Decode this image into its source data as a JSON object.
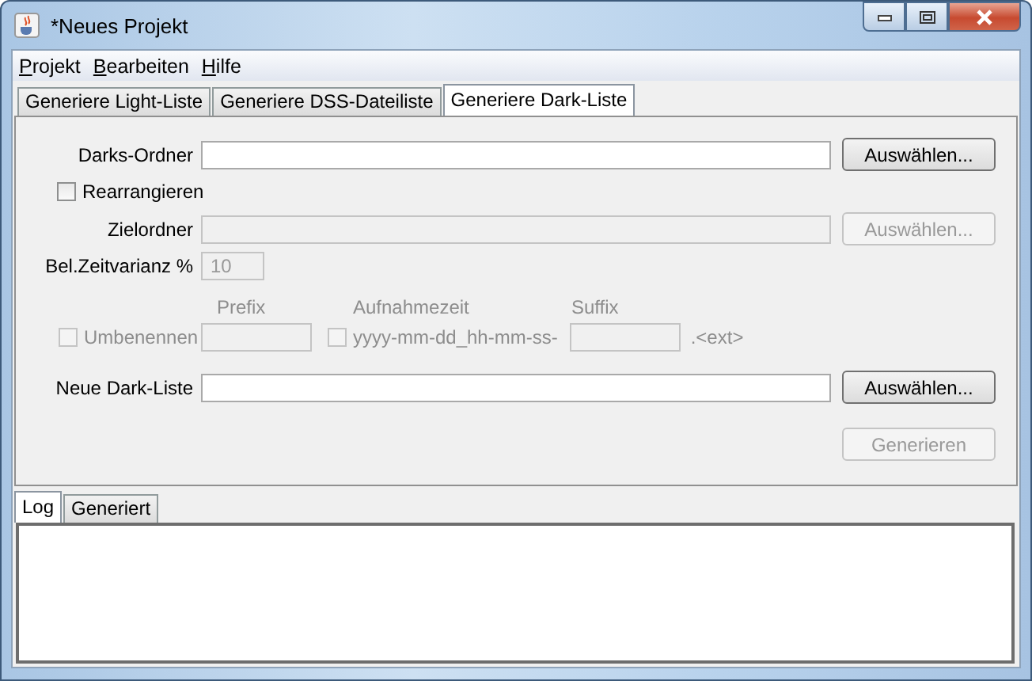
{
  "window": {
    "title": "*Neues Projekt"
  },
  "menu": [
    {
      "label": "Projekt"
    },
    {
      "label": "Bearbeiten"
    },
    {
      "label": "Hilfe"
    }
  ],
  "tabs": [
    {
      "label": "Generiere Light-Liste",
      "selected": false
    },
    {
      "label": "Generiere DSS-Dateiliste",
      "selected": false
    },
    {
      "label": "Generiere Dark-Liste",
      "selected": true
    }
  ],
  "form": {
    "darks_folder": {
      "label": "Darks-Ordner",
      "disabled": false,
      "button": {
        "label": "Auswählen...",
        "disabled": false
      }
    },
    "rearrange": {
      "label": "Rearrangieren",
      "checked": false,
      "disabled": false
    },
    "target_folder": {
      "label": "Zielordner",
      "disabled": true,
      "button": {
        "label": "Auswählen...",
        "disabled": true
      }
    },
    "exposure_variance": {
      "label": "Bel.Zeitvarianz %",
      "value": "10",
      "disabled": true
    },
    "rename": {
      "label": "Umbenennen",
      "checked": false,
      "disabled": true,
      "prefix": {
        "heading": "Prefix",
        "disabled": true
      },
      "timestamp": {
        "heading": "Aufnahmezeit",
        "label": "yyyy-mm-dd_hh-mm-ss-",
        "checked": false,
        "disabled": true
      },
      "suffix": {
        "heading": "Suffix",
        "disabled": true
      },
      "extension": ".<ext>"
    },
    "new_dark_list": {
      "label": "Neue Dark-Liste",
      "disabled": false,
      "button": {
        "label": "Auswählen...",
        "disabled": false
      }
    },
    "generate_button": {
      "label": "Generieren",
      "disabled": true
    }
  },
  "bottom_tabs": [
    {
      "label": "Log",
      "selected": true
    },
    {
      "label": "Generiert",
      "selected": false
    }
  ]
}
